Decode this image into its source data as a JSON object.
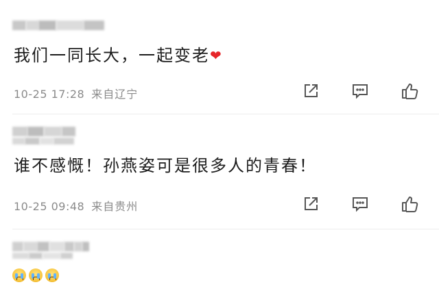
{
  "comments": [
    {
      "text": "我们一同长大，一起变老",
      "heart": "❤",
      "time": "10-25 17:28",
      "location": "来自辽宁",
      "blur_colors": [
        "#c8c8c8",
        "#d8d8d8",
        "#bcbcbc",
        "#dcdcdc",
        "#c4c4c4"
      ]
    },
    {
      "text": "谁不感慨！孙燕姿可是很多人的青春！",
      "time": "10-25 09:48",
      "location": "来自贵州",
      "blur_colors": [
        "#d0d0d0",
        "#bdbdbd",
        "#d6d6d6",
        "#c6c6c6"
      ]
    },
    {
      "text": "",
      "blur_colors": [
        "#cfcfcf",
        "#d9d9d9",
        "#c2c2c2",
        "#e0e0e0",
        "#c9c9c9",
        "#d3d3d3",
        "#bfbfbf"
      ],
      "emoji": [
        "crying-emoji",
        "crying-emoji",
        "crying-emoji"
      ]
    }
  ],
  "icons": {
    "share": "share-icon",
    "comment": "comment-icon",
    "like": "like-icon"
  },
  "colors": {
    "text": "#1c1c1c",
    "meta": "#8a8a8a",
    "heart": "#e6262a",
    "icon_stroke": "#555555"
  }
}
